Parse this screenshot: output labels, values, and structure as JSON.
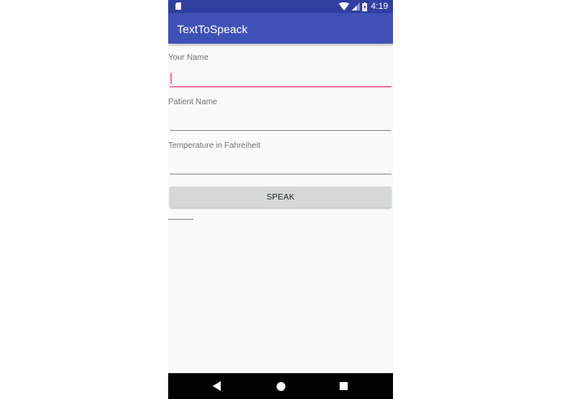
{
  "status_bar": {
    "time": "4:19",
    "icons": [
      "sd-card-icon",
      "wifi-icon",
      "signal-icon",
      "battery-charging-icon"
    ]
  },
  "app_bar": {
    "title": "TextToSpeack"
  },
  "form": {
    "your_name": {
      "label": "Your Name",
      "value": "",
      "focused": true
    },
    "patient_name": {
      "label": "Patient Name",
      "value": ""
    },
    "temperature": {
      "label": "Temperature in Fahreiheit",
      "value": ""
    },
    "speak_button": {
      "label": "SPEAK"
    },
    "result_text": ""
  },
  "nav_bar": {
    "icons": [
      "back-icon",
      "home-icon",
      "recents-icon"
    ]
  },
  "colors": {
    "status_bar": "#303f9f",
    "app_bar": "#3f51b5",
    "accent": "#e91e63",
    "button": "#d6d7d7",
    "background": "#fafafa"
  }
}
